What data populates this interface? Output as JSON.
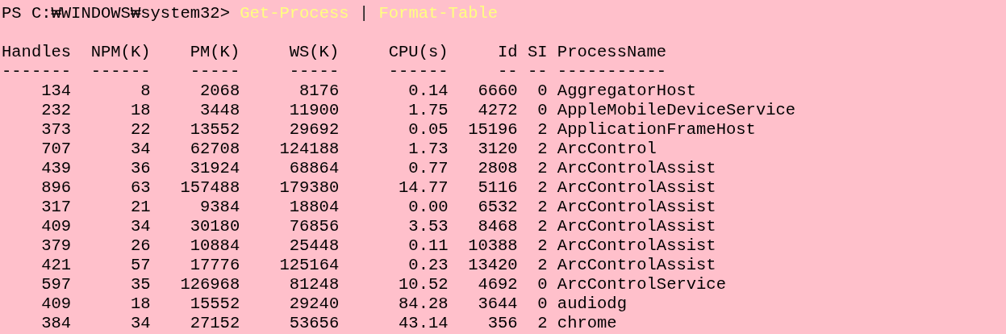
{
  "prompt": "PS C:₩WINDOWS₩system32>",
  "command": [
    {
      "text": "Get-Process",
      "kind": "cmdlet"
    },
    {
      "text": "|",
      "kind": "operator"
    },
    {
      "text": "Format-Table",
      "kind": "cmdlet"
    }
  ],
  "table": {
    "columns": [
      "Handles",
      "NPM(K)",
      "PM(K)",
      "WS(K)",
      "CPU(s)",
      "Id",
      "SI",
      "ProcessName"
    ],
    "underlines": [
      "-------",
      "------",
      "-----",
      "-----",
      "------",
      "--",
      "--",
      "-----------"
    ],
    "rows": [
      [
        "134",
        "8",
        "2068",
        "8176",
        "0.14",
        "6660",
        "0",
        "AggregatorHost"
      ],
      [
        "232",
        "18",
        "3448",
        "11900",
        "1.75",
        "4272",
        "0",
        "AppleMobileDeviceService"
      ],
      [
        "373",
        "22",
        "13552",
        "29692",
        "0.05",
        "15196",
        "2",
        "ApplicationFrameHost"
      ],
      [
        "707",
        "34",
        "62708",
        "124188",
        "1.73",
        "3120",
        "2",
        "ArcControl"
      ],
      [
        "439",
        "36",
        "31924",
        "68864",
        "0.77",
        "2808",
        "2",
        "ArcControlAssist"
      ],
      [
        "896",
        "63",
        "157488",
        "179380",
        "14.77",
        "5116",
        "2",
        "ArcControlAssist"
      ],
      [
        "317",
        "21",
        "9384",
        "18804",
        "0.00",
        "6532",
        "2",
        "ArcControlAssist"
      ],
      [
        "409",
        "34",
        "30180",
        "76856",
        "3.53",
        "8468",
        "2",
        "ArcControlAssist"
      ],
      [
        "379",
        "26",
        "10884",
        "25448",
        "0.11",
        "10388",
        "2",
        "ArcControlAssist"
      ],
      [
        "421",
        "57",
        "17776",
        "125164",
        "0.23",
        "13420",
        "2",
        "ArcControlAssist"
      ],
      [
        "597",
        "35",
        "126968",
        "81248",
        "10.52",
        "4692",
        "0",
        "ArcControlService"
      ],
      [
        "409",
        "18",
        "15552",
        "29240",
        "84.28",
        "3644",
        "0",
        "audiodg"
      ],
      [
        "384",
        "34",
        "27152",
        "53656",
        "43.14",
        "356",
        "2",
        "chrome"
      ]
    ]
  }
}
